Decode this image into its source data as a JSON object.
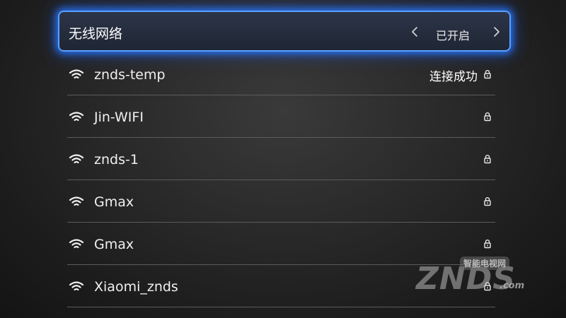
{
  "header": {
    "title": "无线网络",
    "state": "已开启",
    "accent_color": "#3d8bff",
    "left_icon": "chevron-left-icon",
    "right_icon": "chevron-right-icon"
  },
  "networks": [
    {
      "ssid": "znds-temp",
      "status": "连接成功",
      "icon": "wifi-icon",
      "secured": true
    },
    {
      "ssid": "Jin-WIFI",
      "status": "",
      "icon": "wifi-icon",
      "secured": true
    },
    {
      "ssid": "znds-1",
      "status": "",
      "icon": "wifi-icon",
      "secured": true
    },
    {
      "ssid": "Gmax",
      "status": "",
      "icon": "wifi-icon",
      "secured": true
    },
    {
      "ssid": "Gmax",
      "status": "",
      "icon": "wifi-icon",
      "secured": true
    },
    {
      "ssid": "Xiaomi_znds",
      "status": "",
      "icon": "wifi-icon",
      "secured": true
    }
  ],
  "watermark": {
    "brand": "ZNDS",
    "tagline": "智能电视网",
    "domain": ".com"
  }
}
